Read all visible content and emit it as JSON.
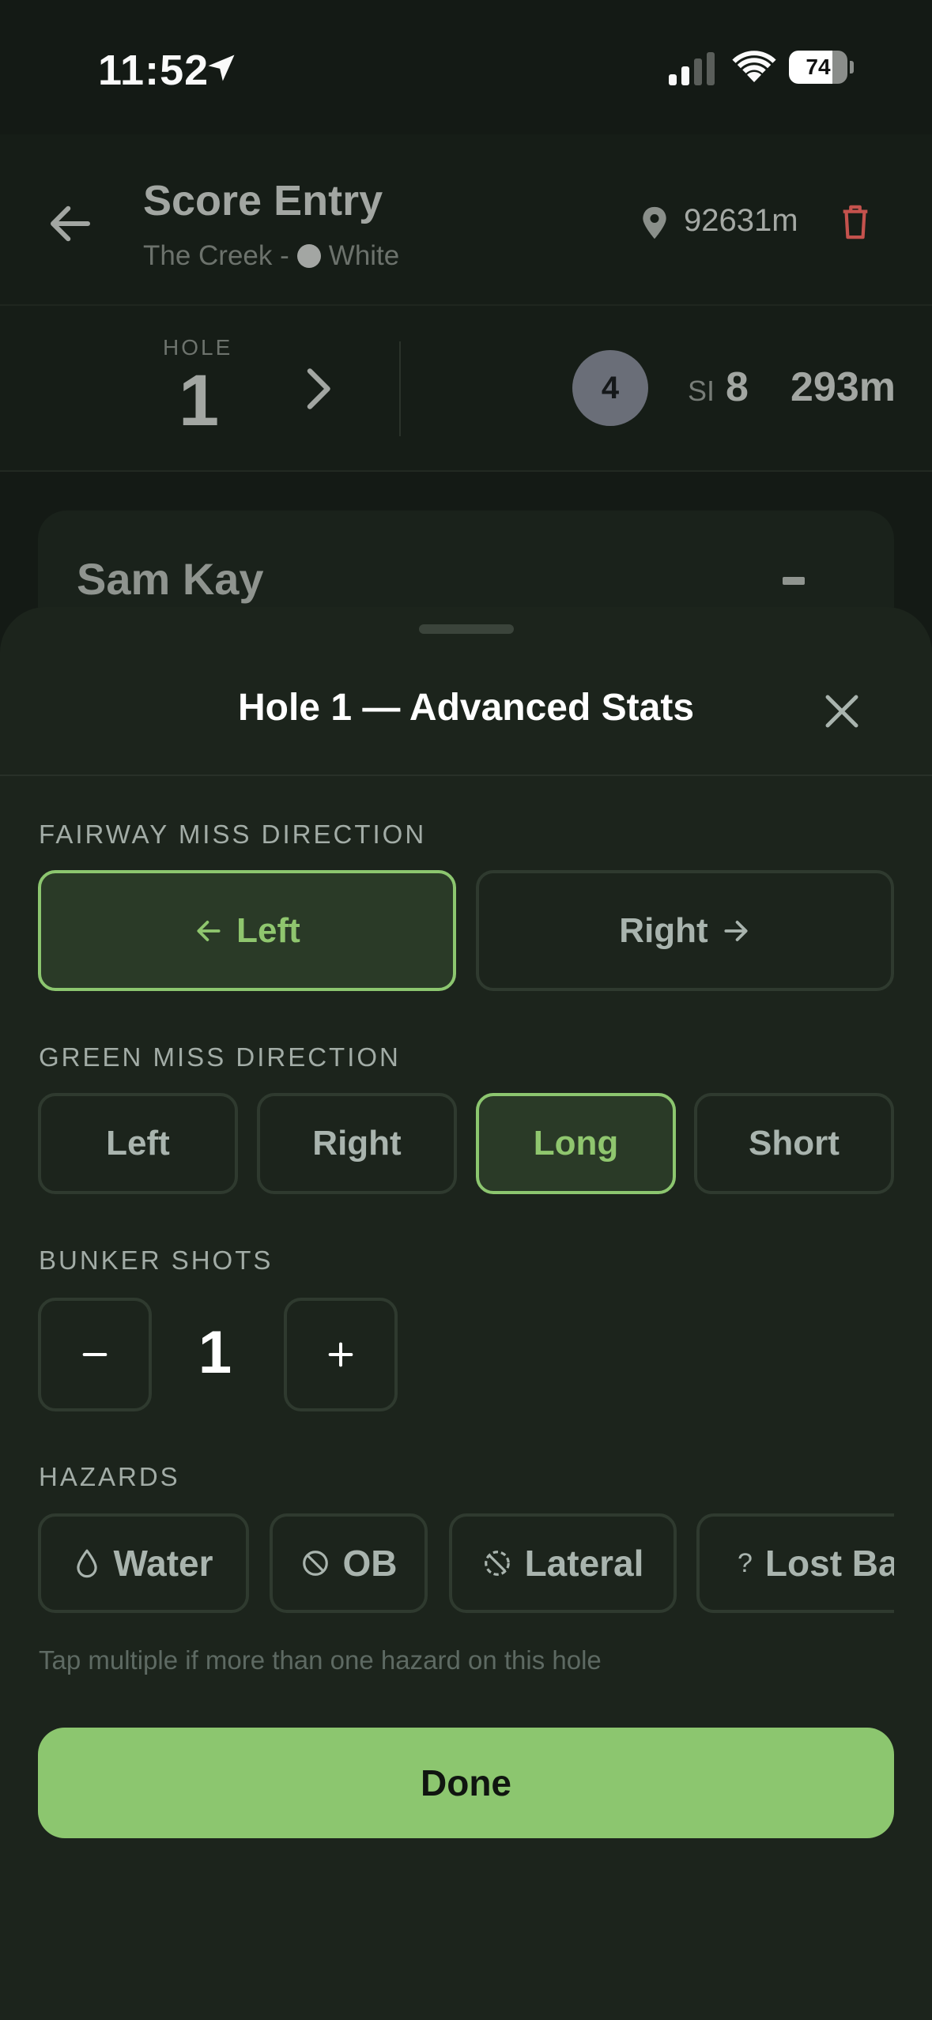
{
  "status_bar": {
    "time": "11:52",
    "battery": "74",
    "battery_level": 0.74
  },
  "header": {
    "title": "Score Entry",
    "course": "The Creek -",
    "tee": "White",
    "tee_color": "#a3a6a3",
    "total_distance": "92631m"
  },
  "hole": {
    "label": "HOLE",
    "number": "1",
    "par": "4",
    "si_label": "SI",
    "si_value": "8",
    "length": "293m"
  },
  "player": {
    "name": "Sam Kay",
    "score": "-"
  },
  "sheet": {
    "title": "Hole 1 — Advanced Stats",
    "fairway": {
      "label": "FAIRWAY MISS DIRECTION",
      "left": "Left",
      "right": "Right",
      "selected": "Left"
    },
    "green": {
      "label": "GREEN MISS DIRECTION",
      "options": [
        "Left",
        "Right",
        "Long",
        "Short"
      ],
      "selected": "Long"
    },
    "bunker": {
      "label": "BUNKER SHOTS",
      "minus": "−",
      "plus": "+",
      "value": "1"
    },
    "hazards": {
      "label": "HAZARDS",
      "options": [
        {
          "label": "Water",
          "icon": "water-drop-icon"
        },
        {
          "label": "OB",
          "icon": "prohibited-icon"
        },
        {
          "label": "Lateral",
          "icon": "prohibited-dashed-icon"
        },
        {
          "label": "Lost Ball",
          "icon": "question-icon"
        }
      ],
      "hint": "Tap multiple if more than one hazard on this hole"
    },
    "done": "Done"
  },
  "colors": {
    "accent": "#8cc66f",
    "background": "#1c241c",
    "danger": "#c4524d"
  }
}
